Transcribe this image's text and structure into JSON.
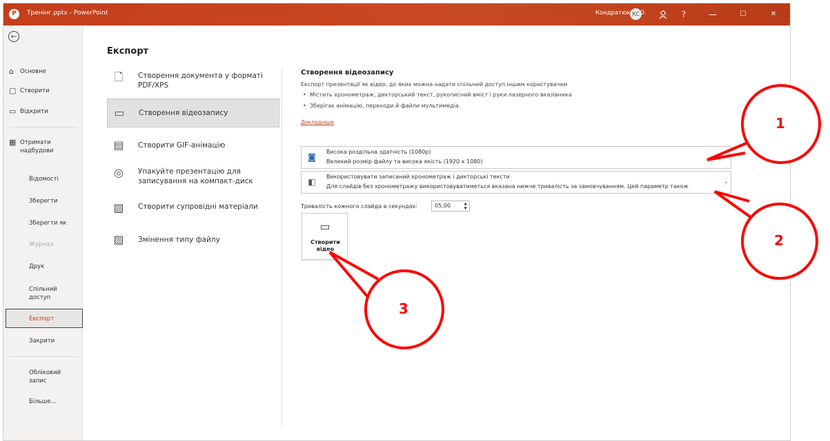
{
  "titlebar": {
    "title": "Тренінг.pptx - PowerPoint",
    "user_name": "Кондратюк С.Ю.",
    "user_initials": "КС",
    "help": "?",
    "minimize": "—",
    "maximize": "☐",
    "close": "✕"
  },
  "sidebar": {
    "back": "←",
    "items": [
      {
        "label": "Основне"
      },
      {
        "label": "Створити"
      },
      {
        "label": "Відкрити"
      },
      {
        "label": "Отримати надбудови"
      },
      {
        "label": "Відомості"
      },
      {
        "label": "Зберегти"
      },
      {
        "label": "Зберегти як"
      },
      {
        "label": "Журнал"
      },
      {
        "label": "Друк"
      },
      {
        "label": "Спільний доступ"
      },
      {
        "label": "Експорт"
      },
      {
        "label": "Закрити"
      },
      {
        "label": "Обліковий запис"
      },
      {
        "label": "Більше..."
      }
    ]
  },
  "main": {
    "title": "Експорт",
    "options": [
      {
        "label": "Створення документа у форматі PDF/XPS"
      },
      {
        "label": "Створення відеозапису"
      },
      {
        "label": "Створити GIF-анімацію"
      },
      {
        "label": "Упакуйте презентацію для записування на компакт-диск"
      },
      {
        "label": "Створити супровідні матеріали"
      },
      {
        "label": "Змінення типу файлу"
      }
    ]
  },
  "video": {
    "heading": "Створення відеозапису",
    "description": "Експорт презентації як відео, до яких можна надати спільний доступ іншим користувачам",
    "bullets": [
      "Містить хронометраж, дикторський текст, рукописний вміст і руки лазерного вказівника",
      "Зберігає анімацію, переходи й файли мультимедіа."
    ],
    "link": "Докладніше",
    "quality": {
      "title": "Висока роздільна здатність (1080p)",
      "subtitle": "Великий розмір файлу та висока якість (1920 x 1080)"
    },
    "timing": {
      "title": "Використовувати записаний хронометраж і дикторські тексти",
      "subtitle": "Для слайдів без хронометражу використовуватиметься вказана нижче тривалість за замовчуванням. Цей параметр також"
    },
    "duration_label": "Тривалість кожного слайда в секундах:",
    "duration_value": "05,00",
    "create_button": "Створити відео"
  },
  "callouts": [
    "1",
    "2",
    "3"
  ],
  "colors": {
    "accent": "#c43e1c",
    "callout": "#ff0000"
  }
}
